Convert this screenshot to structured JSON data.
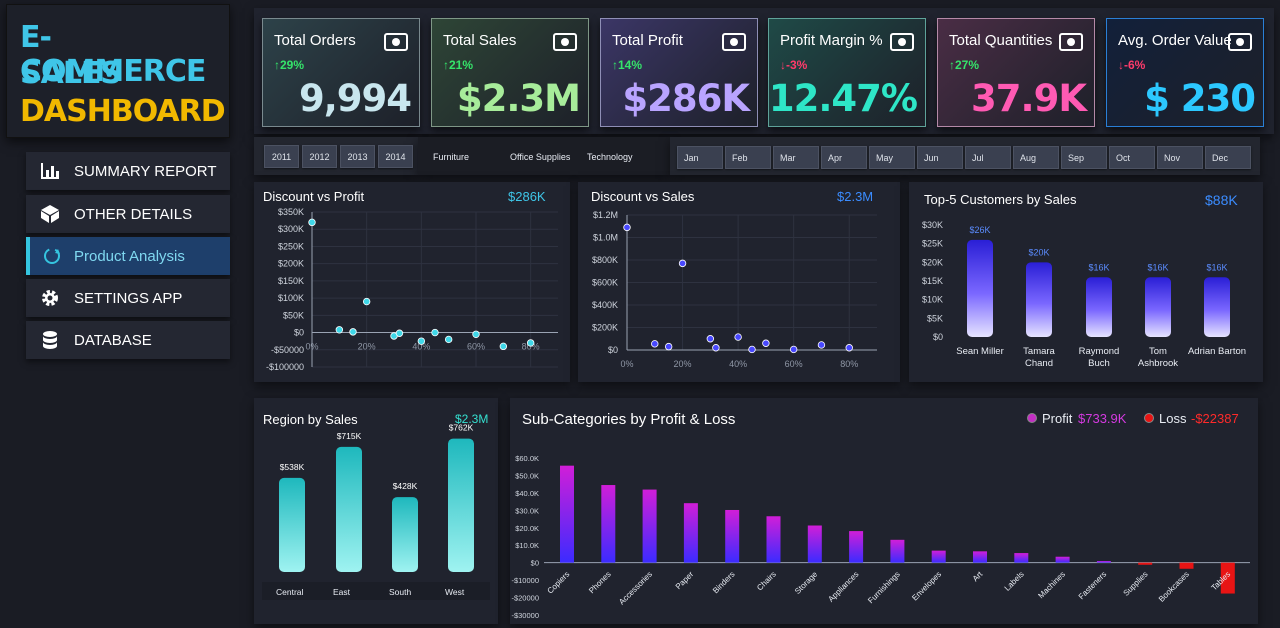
{
  "logo": {
    "line1": "E-COMMERCE",
    "line2": "SALES",
    "line3": "DASHBOARD"
  },
  "nav": [
    {
      "label": "SUMMARY REPORT",
      "icon": "bar-chart-icon"
    },
    {
      "label": "OTHER DETAILS",
      "icon": "cube-icon"
    },
    {
      "label": "Product Analysis",
      "icon": "refresh-icon",
      "active": true
    },
    {
      "label": "SETTINGS APP",
      "icon": "gear-icon"
    },
    {
      "label": "DATABASE",
      "icon": "database-icon"
    }
  ],
  "kpis": [
    {
      "title": "Total Orders",
      "delta": "↑29%",
      "dir": "up",
      "value": "9,994",
      "icon": "users-icon",
      "valueColor": "#c8e6ee",
      "bg": "#2d4249"
    },
    {
      "title": "Total Sales",
      "delta": "↑21%",
      "dir": "up",
      "value": "$2.3M",
      "icon": "chart-growth-icon",
      "valueColor": "#a7ec9a",
      "bg": "#2e4536"
    },
    {
      "title": "Total Profit",
      "delta": "↑14%",
      "dir": "up",
      "value": "$286K",
      "icon": "money-bag-icon",
      "valueColor": "#b9a4ff",
      "bg": "#3b3666"
    },
    {
      "title": "Profit Margin %",
      "delta": "↓-3%",
      "dir": "dn",
      "value": "12.47%",
      "icon": "cash-icon",
      "valueColor": "#2ee6c7",
      "bg": "#1f4a47"
    },
    {
      "title": "Total Quantities",
      "delta": "↑27%",
      "dir": "up",
      "value": "37.9K",
      "icon": "boxes-icon",
      "valueColor": "#ff5ab3",
      "bg": "#4a2d45"
    },
    {
      "title": "Avg. Order Value",
      "delta": "↓-6%",
      "dir": "dn",
      "value": "$ 230",
      "icon": "cart-icon",
      "valueColor": "#2cc8ff",
      "bg": "#12203a"
    }
  ],
  "years": [
    "2011",
    "2012",
    "2013",
    "2014"
  ],
  "categories": [
    "Furniture",
    "Office Supplies",
    "Technology"
  ],
  "months": [
    "Jan",
    "Feb",
    "Mar",
    "Apr",
    "May",
    "Jun",
    "Jul",
    "Aug",
    "Sep",
    "Oct",
    "Nov",
    "Dec"
  ],
  "panels": {
    "discount_profit": {
      "title": "Discount vs Profit",
      "value": "$286K"
    },
    "discount_sales": {
      "title": "Discount vs Sales",
      "value": "$2.3M"
    },
    "top5": {
      "title": "Top-5 Customers by Sales",
      "value": "$88K"
    },
    "region": {
      "title": "Region by Sales",
      "value": "$2.3M"
    },
    "subcat": {
      "title": "Sub-Categories by Profit & Loss",
      "profit_label": "Profit",
      "profit_value": "$733.9K",
      "loss_label": "Loss",
      "loss_value": "-$22387"
    }
  },
  "chart_data": [
    {
      "type": "scatter",
      "title": "Discount vs Profit",
      "x_ticks": [
        "0%",
        "20%",
        "40%",
        "60%",
        "80%"
      ],
      "y_ticks": [
        "$350K",
        "$300K",
        "$250K",
        "$200K",
        "$150K",
        "$100K",
        "$50K",
        "$0",
        "-$50000",
        "-$100000"
      ],
      "ylim": [
        -100000,
        350000
      ],
      "xlim": [
        0,
        0.9
      ],
      "points": [
        [
          0,
          320000
        ],
        [
          0.1,
          8000
        ],
        [
          0.15,
          2000
        ],
        [
          0.2,
          90000
        ],
        [
          0.3,
          -10000
        ],
        [
          0.32,
          -2000
        ],
        [
          0.4,
          -25000
        ],
        [
          0.45,
          0
        ],
        [
          0.5,
          -20000
        ],
        [
          0.6,
          -5000
        ],
        [
          0.7,
          -40000
        ],
        [
          0.8,
          -30000
        ]
      ]
    },
    {
      "type": "scatter",
      "title": "Discount vs Sales",
      "x_ticks": [
        "0%",
        "20%",
        "40%",
        "60%",
        "80%"
      ],
      "y_ticks": [
        "$1.2M",
        "$1.0M",
        "$800K",
        "$600K",
        "$400K",
        "$200K",
        "$0"
      ],
      "ylim": [
        0,
        1200000
      ],
      "xlim": [
        0,
        0.9
      ],
      "points": [
        [
          0,
          1090000
        ],
        [
          0.1,
          55000
        ],
        [
          0.15,
          30000
        ],
        [
          0.2,
          770000
        ],
        [
          0.3,
          100000
        ],
        [
          0.32,
          20000
        ],
        [
          0.4,
          115000
        ],
        [
          0.45,
          5000
        ],
        [
          0.5,
          60000
        ],
        [
          0.6,
          5000
        ],
        [
          0.7,
          45000
        ],
        [
          0.8,
          20000
        ]
      ]
    },
    {
      "type": "bar",
      "title": "Top-5 Customers by Sales",
      "categories": [
        "Sean Miller",
        "Tamara Chand",
        "Raymond Buch",
        "Tom Ashbrook",
        "Adrian Barton"
      ],
      "values": [
        26000,
        20000,
        16000,
        16000,
        16000
      ],
      "labels": [
        "$26K",
        "$20K",
        "$16K",
        "$16K",
        "$16K"
      ],
      "y_ticks": [
        "$30K",
        "$25K",
        "$20K",
        "$15K",
        "$10K",
        "$5K",
        "$0"
      ],
      "ylim": [
        0,
        30000
      ]
    },
    {
      "type": "bar",
      "title": "Region by Sales",
      "categories": [
        "Central",
        "East",
        "South",
        "West"
      ],
      "values": [
        538,
        715,
        428,
        762
      ],
      "labels": [
        "$538K",
        "$715K",
        "$428K",
        "$762K"
      ]
    },
    {
      "type": "bar",
      "title": "Sub-Categories by Profit & Loss",
      "categories": [
        "Copiers",
        "Phones",
        "Accessories",
        "Paper",
        "Binders",
        "Chairs",
        "Storage",
        "Appliances",
        "Furnishings",
        "Envelopes",
        "Art",
        "Labels",
        "Machines",
        "Fasteners",
        "Supplies",
        "Bookcases",
        "Tables"
      ],
      "values": [
        55600,
        44500,
        41900,
        34100,
        30200,
        26600,
        21300,
        18100,
        13100,
        6900,
        6500,
        5500,
        3400,
        950,
        -1200,
        -3500,
        -17700
      ],
      "y_ticks": [
        "$60.0K",
        "$50.0K",
        "$40.0K",
        "$30.0K",
        "$20.0K",
        "$10.0K",
        "$0",
        "-$10000",
        "-$20000",
        "-$30000"
      ],
      "ylim": [
        -30000,
        60000
      ]
    }
  ]
}
